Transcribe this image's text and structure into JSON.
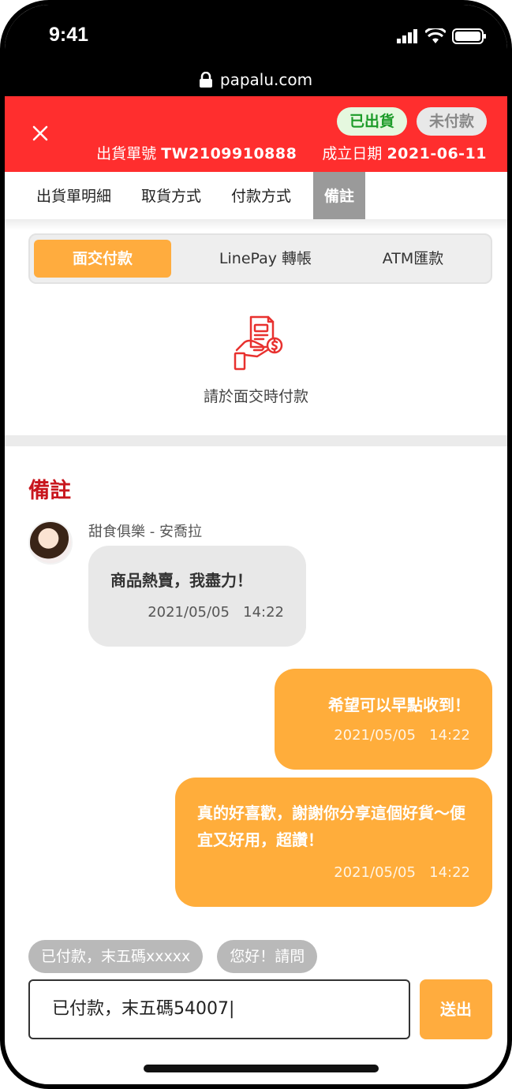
{
  "status_bar": {
    "time": "9:41",
    "icons": [
      "signal-icon",
      "wifi-icon",
      "battery-icon"
    ]
  },
  "browser": {
    "url": "papalu.com",
    "lock_icon": "lock-icon"
  },
  "header": {
    "close_icon": "close-icon",
    "badges": {
      "shipped": "已出貨",
      "unpaid": "未付款"
    },
    "order_label": "出貨單號",
    "order_number": "TW2109910888",
    "date_label": "成立日期",
    "date_value": "2021-06-11",
    "brand_color": "#ff2e2e"
  },
  "tabs": [
    {
      "label": "出貨單明細",
      "active": false
    },
    {
      "label": "取貨方式",
      "active": false
    },
    {
      "label": "付款方式",
      "active": false
    },
    {
      "label": "備註",
      "active": true
    }
  ],
  "payment": {
    "options": [
      {
        "label": "面交付款",
        "active": true
      },
      {
        "label": "LinePay 轉帳",
        "active": false
      },
      {
        "label": "ATM匯款",
        "active": false
      }
    ],
    "icon": "cash-payment-icon",
    "instruction": "請於面交時付款",
    "accent_color": "#ffac3e"
  },
  "notes": {
    "title": "備註",
    "sender": "甜食俱樂 - 安喬拉",
    "messages": [
      {
        "side": "left",
        "text": "商品熱賣，我盡力！",
        "date": "2021/05/05",
        "time": "14:22"
      },
      {
        "side": "right",
        "text": "希望可以早點收到！",
        "date": "2021/05/05",
        "time": "14:22"
      },
      {
        "side": "right",
        "text": "真的好喜歡，謝謝你分享這個好貨～便宜又好用，超讚！",
        "date": "2021/05/05",
        "time": "14:22"
      }
    ]
  },
  "quick_replies": [
    "已付款，末五碼xxxxx",
    "您好！請問"
  ],
  "composer": {
    "value": "已付款，末五碼54007|",
    "send_label": "送出"
  }
}
